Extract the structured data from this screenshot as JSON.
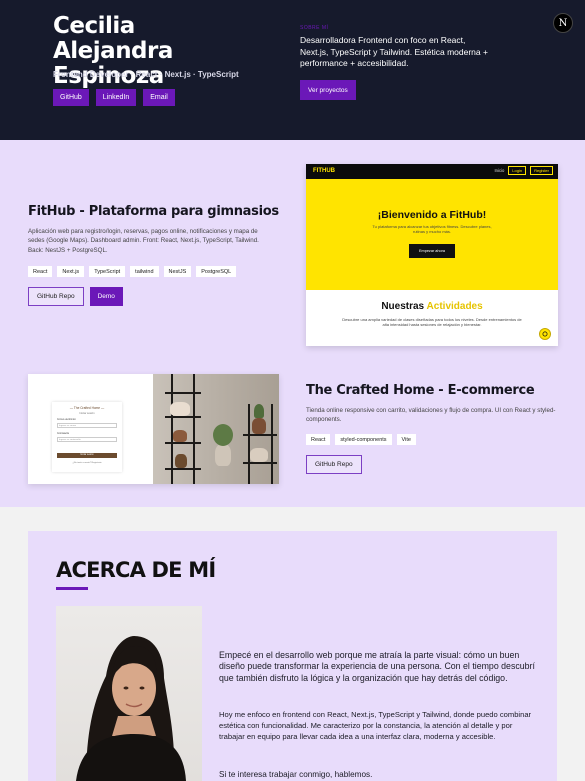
{
  "hero": {
    "name": "Cecilia Alejandra Espinoza",
    "role": "Frontend Developer · React · Next.js · TypeScript",
    "links": [
      "GitHub",
      "LinkedIn",
      "Email"
    ],
    "kicker": "SOBRE MÍ",
    "description": "Desarrolladora Frontend con foco en React, Next.js, TypeScript y Tailwind. Estética moderna + performance + accesibilidad.",
    "cta": "Ver proyectos",
    "badge": "N"
  },
  "projects": [
    {
      "title": "FitHub - Plataforma para gimnasios",
      "description": "Aplicación web para registro/login, reservas, pagos online, notificaciones y mapa de sedes (Google Maps). Dashboard admin. Front: React, Next.js, TypeScript, Tailwind. Back: NestJS + PostgreSQL.",
      "tags": [
        "React",
        "Next.js",
        "TypeScript",
        "tailwind",
        "NestJS",
        "PostgreSQL"
      ],
      "buttons": [
        "GitHub Repo",
        "Demo"
      ],
      "preview": {
        "logo": "FITHUB",
        "nav": [
          "Inicio",
          "Login",
          "Register"
        ],
        "heading": "¡Bienvenido a FitHub!",
        "subheading": "Tu plataforma para alcanzar tus objetivos fitness. Descubre planes, rutinas y mucho más.",
        "button": "Empezar ahora",
        "section_prefix": "Nuestras",
        "section_highlight": "Actividades",
        "section_text": "Descubre una amplia variedad de clases diseñadas para todos los niveles. Desde entrenamientos de alta intensidad hasta sesiones de relajación y bienestar."
      }
    },
    {
      "title": "The Crafted Home - E-commerce",
      "description": "Tienda online responsive con carrito, validaciones y flujo de compra. UI con React y styled-components.",
      "tags": [
        "React",
        "styled-components",
        "Vite"
      ],
      "buttons": [
        "GitHub Repo"
      ],
      "preview": {
        "form_title": "— The Crafted Home —",
        "form_sub": "Iniciar sesión",
        "email_label": "Correo electrónico",
        "email_placeholder": "Ingrese su correo",
        "password_label": "Contraseña",
        "password_placeholder": "Ingrese su contraseña",
        "button": "Iniciar sesión",
        "footer": "¿No tenés cuenta? Registrate"
      }
    }
  ],
  "about": {
    "title": "ACERCA DE MÍ",
    "paragraphs": [
      "Empecé en el desarrollo web porque me atraía la parte visual: cómo un buen diseño puede transformar la experiencia de una persona. Con el tiempo descubrí que también disfruto la lógica y la organización que hay detrás del código.",
      "Hoy me enfoco en frontend con React, Next.js, TypeScript y Tailwind, donde puedo combinar estética con funcionalidad. Me caracterizo por la constancia, la atención al detalle y por trabajar en equipo para llevar cada idea a una interfaz clara, moderna y accesible.",
      "Si te interesa trabajar conmigo, hablemos."
    ]
  },
  "colors": {
    "accent": "#6b18b8",
    "hero_bg": "#161a2c",
    "page_bg": "#e8dcfb",
    "fithub_yellow": "#ffe400"
  }
}
